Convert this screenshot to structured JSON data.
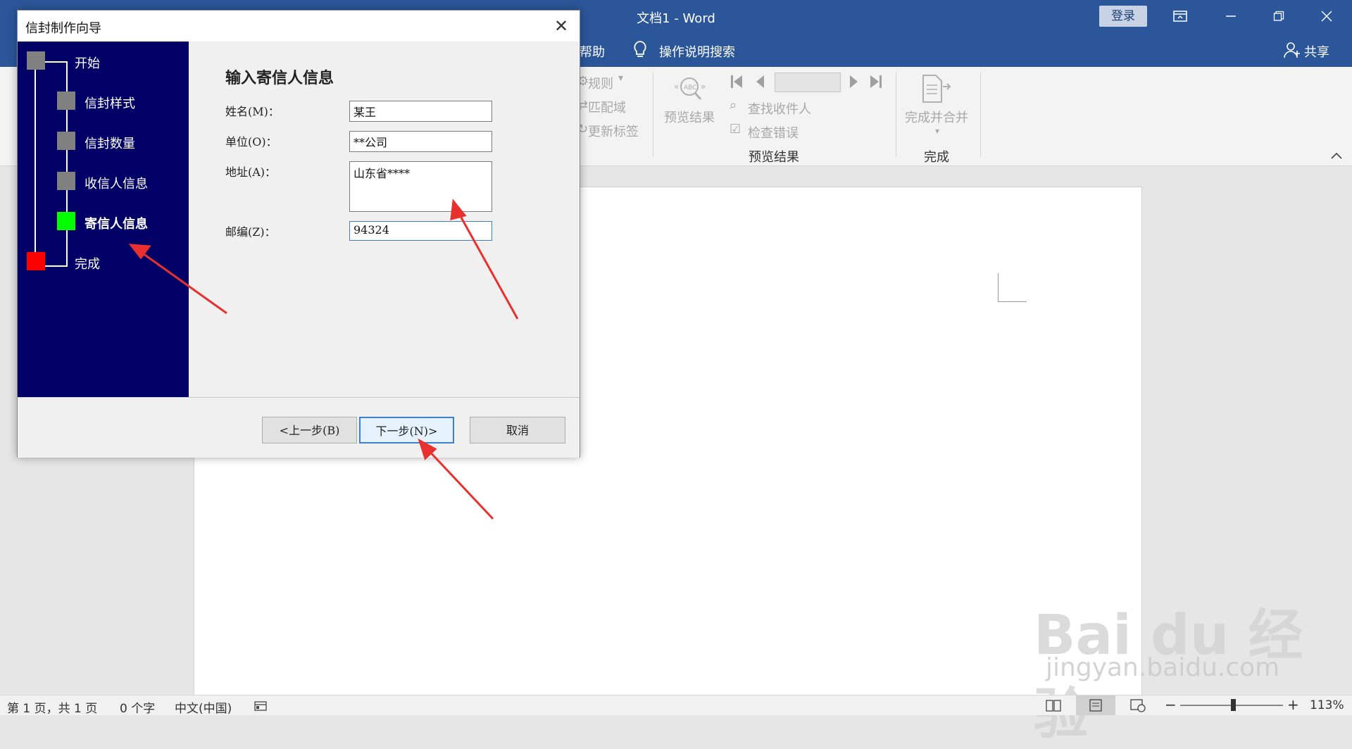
{
  "word": {
    "title": "文档1 - Word",
    "login_label": "登录",
    "tabs": {
      "help": "帮助",
      "tell_me": "操作说明搜索",
      "share": "共享"
    },
    "ribbon": {
      "write_insert": {
        "rules": "规则",
        "match_fields": "匹配域",
        "update_labels": "更新标签"
      },
      "preview": {
        "preview_results": "预览结果",
        "find_recipient": "查找收件人",
        "check_errors": "检查错误",
        "group_label": "预览结果"
      },
      "finish": {
        "finish_merge": "完成并合并",
        "group_label": "完成"
      }
    },
    "status": {
      "page": "第 1 页，共 1 页",
      "words": "0 个字",
      "language": "中文(中国)",
      "zoom": "113%",
      "zoom_fraction": 0.5
    }
  },
  "dialog": {
    "title": "信封制作向导",
    "steps": [
      {
        "label": "开始",
        "color": "#808080",
        "current": false
      },
      {
        "label": "信封样式",
        "color": "#808080",
        "current": false
      },
      {
        "label": "信封数量",
        "color": "#808080",
        "current": false
      },
      {
        "label": "收信人信息",
        "color": "#808080",
        "current": false
      },
      {
        "label": "寄信人信息",
        "color": "#00ff00",
        "current": true
      },
      {
        "label": "完成",
        "color": "#ff0000",
        "current": false
      }
    ],
    "heading": "输入寄信人信息",
    "fields": {
      "name": {
        "label": "姓名(M)：",
        "value": "某王"
      },
      "company": {
        "label": "单位(O)：",
        "value": "**公司"
      },
      "address": {
        "label": "地址(A)：",
        "value": "山东省****"
      },
      "zip": {
        "label": "邮编(Z)：",
        "value": "94324"
      }
    },
    "buttons": {
      "prev": "<上一步(B)",
      "next": "下一步(N)>",
      "cancel": "取消"
    }
  },
  "watermark": {
    "main": "Bai du 经验",
    "sub": "jingyan.baidu.com"
  },
  "colors": {
    "word_blue": "#2b579a",
    "wizard_sidebar": "#000066",
    "arrow": "#e8312f"
  }
}
